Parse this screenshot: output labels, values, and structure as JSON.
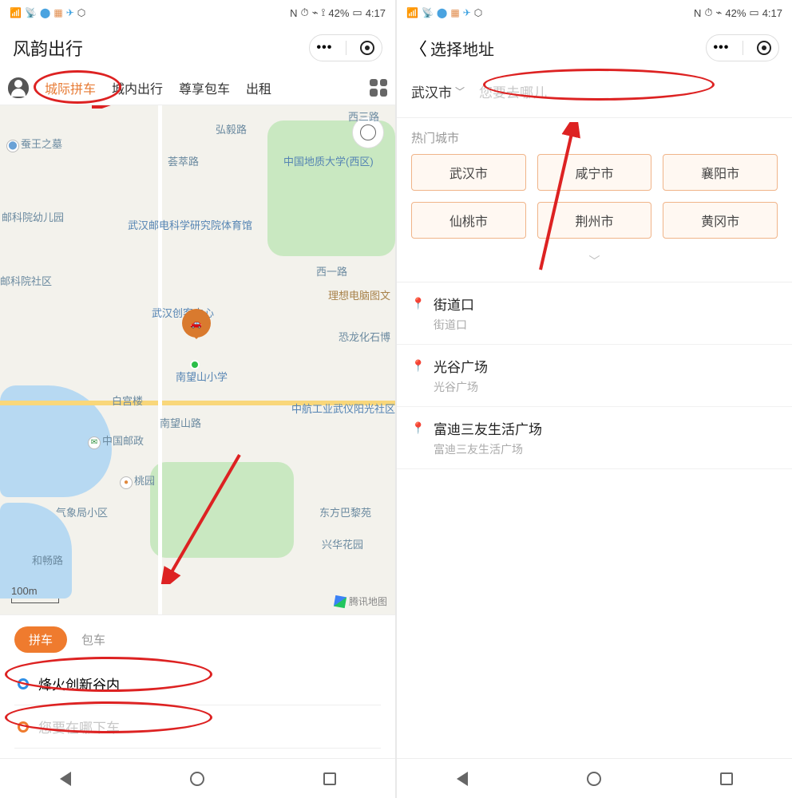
{
  "status": {
    "signal": "4G",
    "wifi": "wifi",
    "nfc": "N",
    "alarm": "⏰",
    "bt": "BT",
    "battery_pct": "42%",
    "time": "4:17"
  },
  "left": {
    "app_title": "风韵出行",
    "tabs": [
      "城际拼车",
      "城内出行",
      "尊享包车",
      "出租"
    ],
    "active_tab_index": 0,
    "map": {
      "scale_label": "100m",
      "attribution": "腾讯地图",
      "labels": {
        "l0": "西三路",
        "l1": "蚕王之墓",
        "l2": "邮科院幼儿园",
        "l3": "邮科院社区",
        "l4": "武汉邮电科学研究院体育馆",
        "l5": "弘毅路",
        "l6": "荟萃路",
        "l7": "中国地质大学(西区)",
        "l8": "西一路",
        "l9": "理想电脑图文",
        "l10": "武汉创客中心",
        "l11": "恐龙化石博",
        "l12": "南望山小学",
        "l13": "白宫楼",
        "l14": "南望山路",
        "l15": "中航工业武仪阳光社区",
        "l16": "中国邮政",
        "l17": "桃园",
        "l18": "气象局小区",
        "l19": "东方巴黎苑",
        "l20": "兴华花园",
        "l21": "和畅路"
      }
    },
    "sheet": {
      "mode_active": "拼车",
      "mode_other": "包车",
      "pickup": "烽火创新谷内",
      "dropoff_placeholder": "您要在哪下车"
    }
  },
  "right": {
    "header_title": "选择地址",
    "city_selected": "武汉市",
    "search_placeholder": "您要去哪儿",
    "hot_cities_label": "热门城市",
    "hot_cities": [
      "武汉市",
      "咸宁市",
      "襄阳市",
      "仙桃市",
      "荆州市",
      "黄冈市"
    ],
    "places": [
      {
        "title": "街道口",
        "sub": "街道口"
      },
      {
        "title": "光谷广场",
        "sub": "光谷广场"
      },
      {
        "title": "富迪三友生活广场",
        "sub": "富迪三友生活广场"
      }
    ]
  },
  "annotation_color": "#d22"
}
